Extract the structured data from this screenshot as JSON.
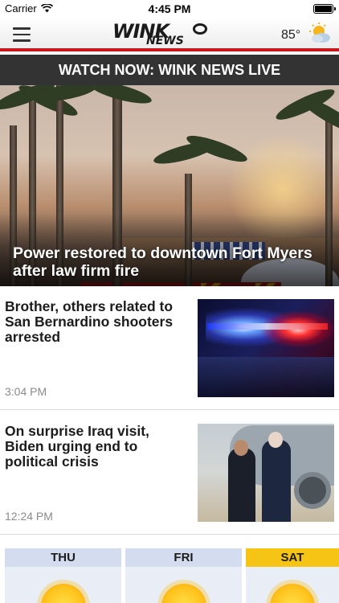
{
  "status_bar": {
    "carrier": "Carrier",
    "time": "4:45 PM"
  },
  "header": {
    "logo_main": "WINK",
    "logo_sub": "NEWS",
    "temperature": "85°",
    "weather_icon": "partly-sunny-icon",
    "accent_color": "#c8181e"
  },
  "live_banner": {
    "label": "WATCH NOW: WINK NEWS LIVE"
  },
  "hero": {
    "title": "Power restored to downtown Fort Myers after law firm fire"
  },
  "stories": [
    {
      "title": "Brother, others related to San Bernardino shooters arrested",
      "time": "3:04 PM",
      "thumbnail": "police-lights"
    },
    {
      "title": "On surprise Iraq visit, Biden urging end to political crisis",
      "time": "12:24 PM",
      "thumbnail": "biden-handshake"
    }
  ],
  "forecast": {
    "days": [
      {
        "label": "THU",
        "icon": "sun-icon"
      },
      {
        "label": "FRI",
        "icon": "sun-icon"
      },
      {
        "label": "SAT",
        "icon": "sun-icon"
      }
    ],
    "active_color": "#f5c415"
  }
}
